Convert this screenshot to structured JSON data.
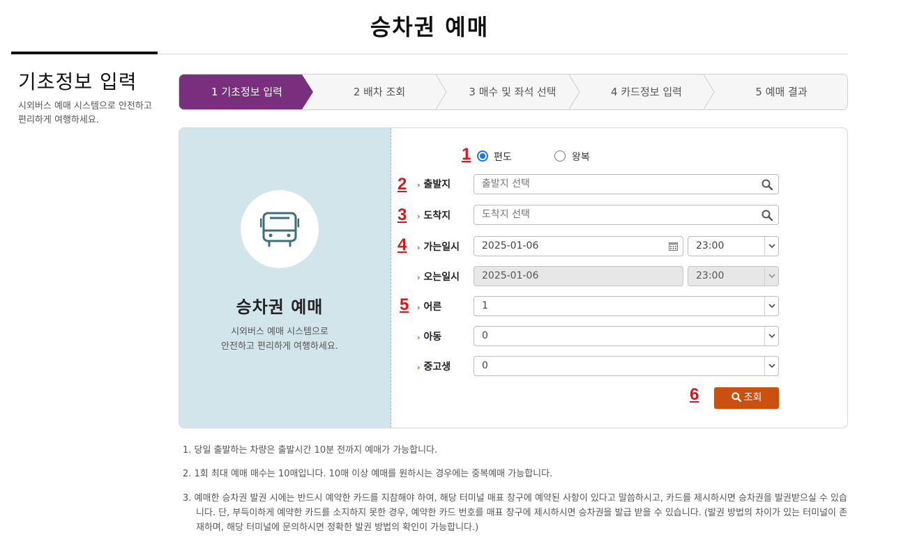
{
  "page_title": "승차권 예매",
  "section": {
    "title": "기초정보 입력",
    "desc": "시외버스 예매 시스템으로 안전하고 편리하게 여행하세요."
  },
  "steps": [
    {
      "label": "1 기초정보 입력",
      "active": true
    },
    {
      "label": "2 배차 조회",
      "active": false
    },
    {
      "label": "3 매수 및 좌석 선택",
      "active": false
    },
    {
      "label": "4 카드정보 입력",
      "active": false
    },
    {
      "label": "5 예매 결과",
      "active": false
    }
  ],
  "left_panel": {
    "icon": "bus-icon",
    "title": "승차권 예매",
    "desc_line1": "시외버스 예매 시스템으로",
    "desc_line2": "안전하고 편리하게 여행하세요."
  },
  "markers": [
    "1",
    "2",
    "3",
    "4",
    "5",
    "6"
  ],
  "trip_type": {
    "options": [
      "편도",
      "왕복"
    ],
    "selected": "편도"
  },
  "form": {
    "departure": {
      "label": "출발지",
      "placeholder": "출발지 선택"
    },
    "arrival": {
      "label": "도착지",
      "placeholder": "도착지 선택"
    },
    "go_datetime": {
      "label": "가는일시",
      "date": "2025-01-06",
      "time": "23:00"
    },
    "return_datetime": {
      "label": "오는일시",
      "date": "2025-01-06",
      "time": "23:00",
      "disabled": true
    },
    "adult": {
      "label": "어른",
      "value": "1"
    },
    "child": {
      "label": "아동",
      "value": "0"
    },
    "student": {
      "label": "중고생",
      "value": "0"
    }
  },
  "search_button": {
    "label": "조회"
  },
  "notes": [
    "1. 당일 출발하는 차량은 출발시간 10분 전까지 예매가 가능합니다.",
    "2. 1회 최대 예매 매수는 10매입니다. 10매 이상 예매를 원하시는 경우에는 중복예매 가능합니다.",
    "3. 예매한 승차권 발권 시에는 반드시 예약한 카드를 지참해야 하여, 해당 터미널 매표 창구에 예약된 사항이 있다고 말씀하시고, 카드를 제시하시면 승차권을 발권받으실 수 있습니다. 단, 부득이하게 예약한 카드를 소지하지 못한 경우, 예약한 카드 번호를 매표 창구에 제시하시면 승차권을 발급 받을 수 있습니다. (발권 방법의 차이가 있는 터미널이 존재하며, 해당 터미널에 문의하시면 정확한 발권 방법의 확인이 가능합니다.)"
  ],
  "colors": {
    "active_step": "#7a2e7e",
    "accent_orange": "#c9500e",
    "panel_bg": "#d2e5ea",
    "icon_teal": "#3b6f80",
    "marker_red": "#e0151b"
  }
}
